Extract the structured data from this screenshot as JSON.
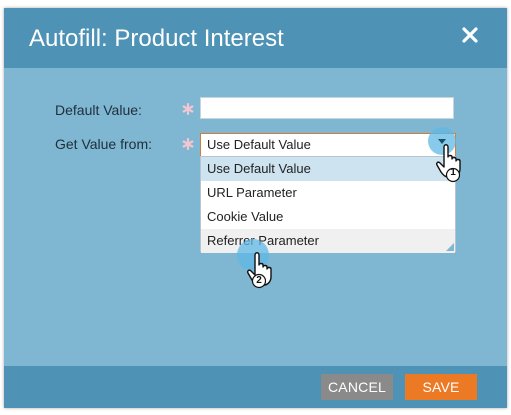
{
  "dialog": {
    "title": "Autofill: Product Interest",
    "close_icon": "close-icon"
  },
  "form": {
    "default_value": {
      "label": "Default Value:",
      "value": "",
      "required_icon": "asterisk-icon"
    },
    "get_value_from": {
      "label": "Get Value from:",
      "selected": "Use Default Value",
      "required_icon": "asterisk-icon",
      "caret_icon": "dropdown-caret-icon",
      "options": [
        "Use Default Value",
        "URL Parameter",
        "Cookie Value",
        "Referrer Parameter"
      ]
    }
  },
  "callouts": [
    {
      "number": "1",
      "icon": "hand-cursor-icon"
    },
    {
      "number": "2",
      "icon": "hand-cursor-icon"
    }
  ],
  "footer": {
    "cancel_label": "CANCEL",
    "save_label": "SAVE"
  },
  "colors": {
    "header": "#4e93b5",
    "body": "#7fb6d2",
    "save": "#ec7a25",
    "cancel": "#8a8a8a",
    "required": "#f2c6d2",
    "callout": "#5fb8e6"
  }
}
